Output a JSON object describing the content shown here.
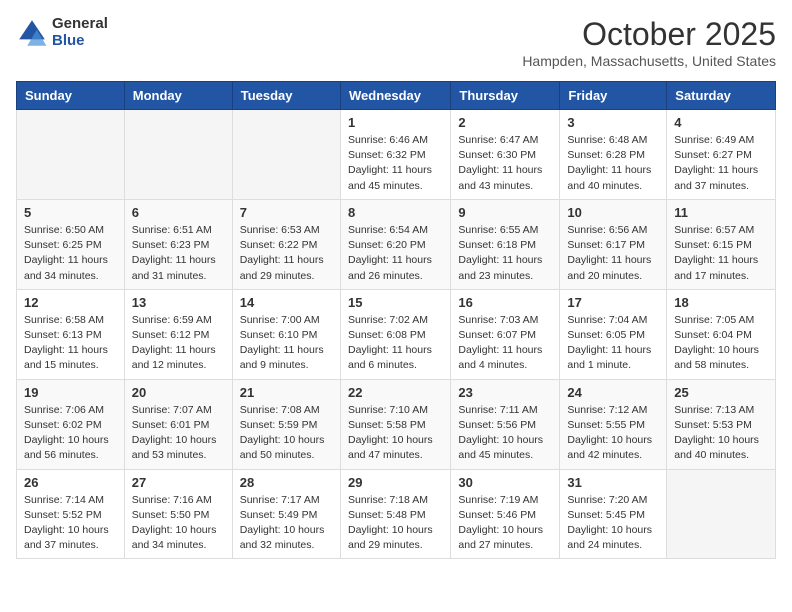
{
  "logo": {
    "general": "General",
    "blue": "Blue"
  },
  "title": "October 2025",
  "location": "Hampden, Massachusetts, United States",
  "days_of_week": [
    "Sunday",
    "Monday",
    "Tuesday",
    "Wednesday",
    "Thursday",
    "Friday",
    "Saturday"
  ],
  "weeks": [
    [
      {
        "day": "",
        "info": ""
      },
      {
        "day": "",
        "info": ""
      },
      {
        "day": "",
        "info": ""
      },
      {
        "day": "1",
        "info": "Sunrise: 6:46 AM\nSunset: 6:32 PM\nDaylight: 11 hours and 45 minutes."
      },
      {
        "day": "2",
        "info": "Sunrise: 6:47 AM\nSunset: 6:30 PM\nDaylight: 11 hours and 43 minutes."
      },
      {
        "day": "3",
        "info": "Sunrise: 6:48 AM\nSunset: 6:28 PM\nDaylight: 11 hours and 40 minutes."
      },
      {
        "day": "4",
        "info": "Sunrise: 6:49 AM\nSunset: 6:27 PM\nDaylight: 11 hours and 37 minutes."
      }
    ],
    [
      {
        "day": "5",
        "info": "Sunrise: 6:50 AM\nSunset: 6:25 PM\nDaylight: 11 hours and 34 minutes."
      },
      {
        "day": "6",
        "info": "Sunrise: 6:51 AM\nSunset: 6:23 PM\nDaylight: 11 hours and 31 minutes."
      },
      {
        "day": "7",
        "info": "Sunrise: 6:53 AM\nSunset: 6:22 PM\nDaylight: 11 hours and 29 minutes."
      },
      {
        "day": "8",
        "info": "Sunrise: 6:54 AM\nSunset: 6:20 PM\nDaylight: 11 hours and 26 minutes."
      },
      {
        "day": "9",
        "info": "Sunrise: 6:55 AM\nSunset: 6:18 PM\nDaylight: 11 hours and 23 minutes."
      },
      {
        "day": "10",
        "info": "Sunrise: 6:56 AM\nSunset: 6:17 PM\nDaylight: 11 hours and 20 minutes."
      },
      {
        "day": "11",
        "info": "Sunrise: 6:57 AM\nSunset: 6:15 PM\nDaylight: 11 hours and 17 minutes."
      }
    ],
    [
      {
        "day": "12",
        "info": "Sunrise: 6:58 AM\nSunset: 6:13 PM\nDaylight: 11 hours and 15 minutes."
      },
      {
        "day": "13",
        "info": "Sunrise: 6:59 AM\nSunset: 6:12 PM\nDaylight: 11 hours and 12 minutes."
      },
      {
        "day": "14",
        "info": "Sunrise: 7:00 AM\nSunset: 6:10 PM\nDaylight: 11 hours and 9 minutes."
      },
      {
        "day": "15",
        "info": "Sunrise: 7:02 AM\nSunset: 6:08 PM\nDaylight: 11 hours and 6 minutes."
      },
      {
        "day": "16",
        "info": "Sunrise: 7:03 AM\nSunset: 6:07 PM\nDaylight: 11 hours and 4 minutes."
      },
      {
        "day": "17",
        "info": "Sunrise: 7:04 AM\nSunset: 6:05 PM\nDaylight: 11 hours and 1 minute."
      },
      {
        "day": "18",
        "info": "Sunrise: 7:05 AM\nSunset: 6:04 PM\nDaylight: 10 hours and 58 minutes."
      }
    ],
    [
      {
        "day": "19",
        "info": "Sunrise: 7:06 AM\nSunset: 6:02 PM\nDaylight: 10 hours and 56 minutes."
      },
      {
        "day": "20",
        "info": "Sunrise: 7:07 AM\nSunset: 6:01 PM\nDaylight: 10 hours and 53 minutes."
      },
      {
        "day": "21",
        "info": "Sunrise: 7:08 AM\nSunset: 5:59 PM\nDaylight: 10 hours and 50 minutes."
      },
      {
        "day": "22",
        "info": "Sunrise: 7:10 AM\nSunset: 5:58 PM\nDaylight: 10 hours and 47 minutes."
      },
      {
        "day": "23",
        "info": "Sunrise: 7:11 AM\nSunset: 5:56 PM\nDaylight: 10 hours and 45 minutes."
      },
      {
        "day": "24",
        "info": "Sunrise: 7:12 AM\nSunset: 5:55 PM\nDaylight: 10 hours and 42 minutes."
      },
      {
        "day": "25",
        "info": "Sunrise: 7:13 AM\nSunset: 5:53 PM\nDaylight: 10 hours and 40 minutes."
      }
    ],
    [
      {
        "day": "26",
        "info": "Sunrise: 7:14 AM\nSunset: 5:52 PM\nDaylight: 10 hours and 37 minutes."
      },
      {
        "day": "27",
        "info": "Sunrise: 7:16 AM\nSunset: 5:50 PM\nDaylight: 10 hours and 34 minutes."
      },
      {
        "day": "28",
        "info": "Sunrise: 7:17 AM\nSunset: 5:49 PM\nDaylight: 10 hours and 32 minutes."
      },
      {
        "day": "29",
        "info": "Sunrise: 7:18 AM\nSunset: 5:48 PM\nDaylight: 10 hours and 29 minutes."
      },
      {
        "day": "30",
        "info": "Sunrise: 7:19 AM\nSunset: 5:46 PM\nDaylight: 10 hours and 27 minutes."
      },
      {
        "day": "31",
        "info": "Sunrise: 7:20 AM\nSunset: 5:45 PM\nDaylight: 10 hours and 24 minutes."
      },
      {
        "day": "",
        "info": ""
      }
    ]
  ]
}
